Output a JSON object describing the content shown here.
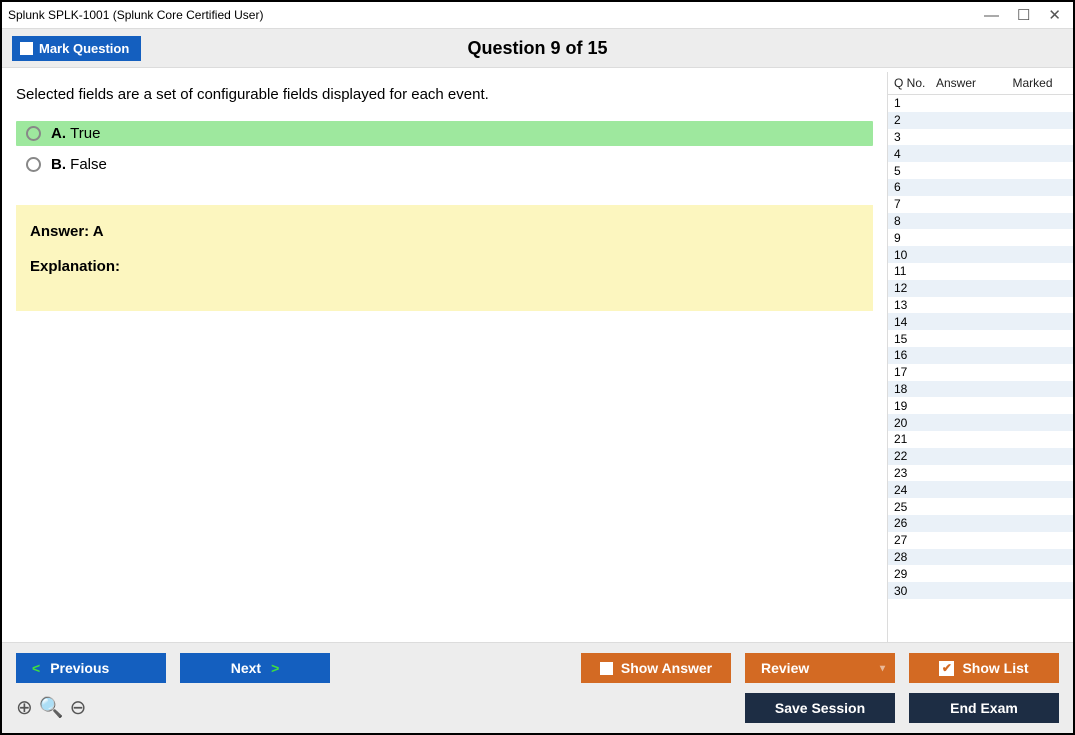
{
  "window": {
    "title": "Splunk SPLK-1001 (Splunk Core Certified User)"
  },
  "header": {
    "mark_label": "Mark Question",
    "question_heading": "Question 9 of 15"
  },
  "question": {
    "text": "Selected fields are a set of configurable fields displayed for each event.",
    "options": [
      {
        "letter": "A.",
        "text": "True",
        "highlight": true
      },
      {
        "letter": "B.",
        "text": "False",
        "highlight": false
      }
    ],
    "answer_label": "Answer: A",
    "explanation_label": "Explanation:"
  },
  "sidepanel": {
    "col_qno": "Q No.",
    "col_answer": "Answer",
    "col_marked": "Marked",
    "row_count": 30
  },
  "footer": {
    "previous": "Previous",
    "next": "Next",
    "show_answer": "Show Answer",
    "review": "Review",
    "show_list": "Show List",
    "save_session": "Save Session",
    "end_exam": "End Exam"
  }
}
